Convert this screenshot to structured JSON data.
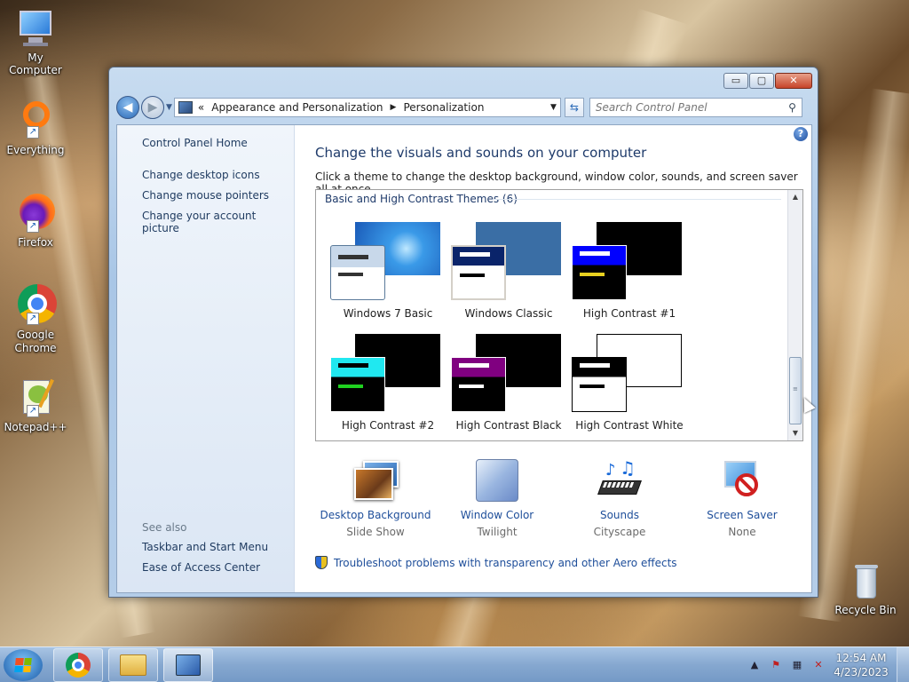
{
  "desktop": {
    "icons": [
      {
        "label": "My Computer",
        "icon": "computer-icon"
      },
      {
        "label": "Everything",
        "icon": "everything-icon"
      },
      {
        "label": "Firefox",
        "icon": "firefox-icon"
      },
      {
        "label": "Google Chrome",
        "icon": "chrome-icon"
      },
      {
        "label": "Notepad++",
        "icon": "notepadpp-icon"
      },
      {
        "label": "Recycle Bin",
        "icon": "recycle-bin-icon"
      }
    ]
  },
  "window": {
    "controls": {
      "minimize": "▭",
      "maximize": "▢",
      "close": "✕"
    },
    "address": {
      "prefix": "«",
      "crumbs": [
        "Appearance and Personalization",
        "Personalization"
      ],
      "separator": "▶",
      "dropdown": "▼"
    },
    "search": {
      "placeholder": "Search Control Panel"
    },
    "left_pane": {
      "home": "Control Panel Home",
      "links": [
        "Change desktop icons",
        "Change mouse pointers",
        "Change your account picture"
      ],
      "see_also_label": "See also",
      "see_also": [
        "Taskbar and Start Menu",
        "Ease of Access Center"
      ]
    },
    "main": {
      "heading": "Change the visuals and sounds on your computer",
      "subheading": "Click a theme to change the desktop background, window color, sounds, and screen saver all at once.",
      "group_label": "Basic and High Contrast Themes (6)",
      "themes": [
        {
          "name": "Windows 7 Basic",
          "bg": "#2a7ad8",
          "win": "#d8e4f0",
          "bar1": "#333333",
          "bar2": "#333333"
        },
        {
          "name": "Windows Classic",
          "bg": "#3a6ea5",
          "win": "#ffffff",
          "bar1": "#ffffff",
          "bar2": "#000000",
          "title": "#0a246a"
        },
        {
          "name": "High Contrast #1",
          "bg": "#000000",
          "win": "#000000",
          "bar1": "#ffffff",
          "bar2": "#e8d020",
          "title": "#0000ff"
        },
        {
          "name": "High Contrast #2",
          "bg": "#000000",
          "win": "#000000",
          "bar1": "#000000",
          "bar2": "#20d020",
          "title": "#20e8f0"
        },
        {
          "name": "High Contrast Black",
          "bg": "#000000",
          "win": "#000000",
          "bar1": "#ffffff",
          "bar2": "#ffffff",
          "title": "#800080"
        },
        {
          "name": "High Contrast White",
          "bg": "#ffffff",
          "win": "#ffffff",
          "bar1": "#000000",
          "bar2": "#000000",
          "title": "#000000"
        }
      ],
      "bottom": [
        {
          "label": "Desktop Background",
          "value": "Slide Show",
          "icon": "desktop-background-icon"
        },
        {
          "label": "Window Color",
          "value": "Twilight",
          "icon": "window-color-icon"
        },
        {
          "label": "Sounds",
          "value": "Cityscape",
          "icon": "sounds-icon"
        },
        {
          "label": "Screen Saver",
          "value": "None",
          "icon": "screen-saver-icon"
        }
      ],
      "troubleshoot": "Troubleshoot problems with transparency and other Aero effects"
    }
  },
  "taskbar": {
    "clock_time": "12:54 AM",
    "clock_date": "4/23/2023",
    "tray_arrow": "▲"
  }
}
